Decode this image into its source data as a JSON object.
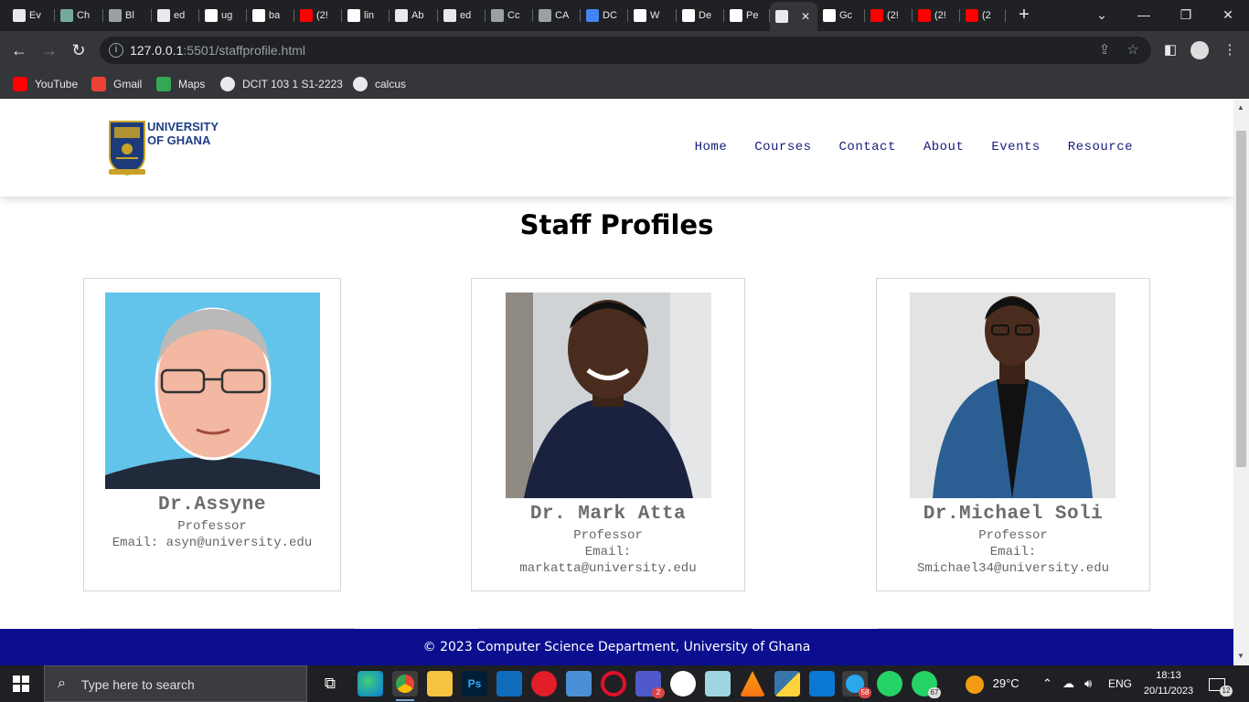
{
  "browser": {
    "tabs": [
      {
        "title": "Ev",
        "icon": "page-icon",
        "color": "#e8eaed"
      },
      {
        "title": "Ch",
        "icon": "chatgpt-icon",
        "color": "#74aa9c"
      },
      {
        "title": "Bl",
        "icon": "globe-icon",
        "color": "#9aa0a6"
      },
      {
        "title": "ed",
        "icon": "page-icon",
        "color": "#e8eaed"
      },
      {
        "title": "ug",
        "icon": "google-icon",
        "color": "#fff"
      },
      {
        "title": "ba",
        "icon": "google-icon",
        "color": "#fff"
      },
      {
        "title": "(2!",
        "icon": "youtube-icon",
        "color": "#ff0000"
      },
      {
        "title": "lin",
        "icon": "google-icon",
        "color": "#fff"
      },
      {
        "title": "Ab",
        "icon": "page-icon",
        "color": "#e8eaed"
      },
      {
        "title": "ed",
        "icon": "page-icon",
        "color": "#e8eaed"
      },
      {
        "title": "Cc",
        "icon": "globe-icon",
        "color": "#9aa0a6"
      },
      {
        "title": "CA",
        "icon": "globe-icon",
        "color": "#9aa0a6"
      },
      {
        "title": "DC",
        "icon": "docs-icon",
        "color": "#4285f4"
      },
      {
        "title": "W",
        "icon": "github-icon",
        "color": "#fff"
      },
      {
        "title": "De",
        "icon": "github-icon",
        "color": "#fff"
      },
      {
        "title": "Pe",
        "icon": "github-icon",
        "color": "#fff"
      },
      {
        "title": "",
        "icon": "page-icon",
        "color": "#e8eaed",
        "active": true
      },
      {
        "title": "Gc",
        "icon": "google-icon",
        "color": "#fff"
      },
      {
        "title": "(2!",
        "icon": "youtube-icon",
        "color": "#ff0000"
      },
      {
        "title": "(2!",
        "icon": "youtube-icon",
        "color": "#ff0000"
      },
      {
        "title": "(2",
        "icon": "youtube-icon",
        "color": "#ff0000"
      }
    ],
    "url_host": "127.0.0.1",
    "url_rest": ":5501/staffprofile.html",
    "bookmarks": [
      {
        "label": "YouTube",
        "icon": "youtube-icon",
        "color": "#ff0000"
      },
      {
        "label": "Gmail",
        "icon": "gmail-icon",
        "color": "#ea4335"
      },
      {
        "label": "Maps",
        "icon": "maps-icon",
        "color": "#34a853"
      },
      {
        "label": "DCIT 103 1 S1-2223",
        "icon": "globe-icon",
        "color": "#e8eaed"
      },
      {
        "label": "calcus",
        "icon": "globe-icon",
        "color": "#e8eaed"
      }
    ]
  },
  "site": {
    "logo_line1": "UNIVERSITY",
    "logo_line2": "OF GHANA",
    "nav": [
      "Home",
      "Courses",
      "Contact",
      "About",
      "Events",
      "Resource"
    ],
    "title": "Staff Profiles",
    "staff": [
      {
        "name": "Dr.Assyne",
        "role": "Professor",
        "email": "Email: asyn@university.edu"
      },
      {
        "name": "Dr. Mark Atta",
        "role": "Professor",
        "email_label": "Email:",
        "email": "markatta@university.edu"
      },
      {
        "name": "Dr.Michael Soli",
        "role": "Professor",
        "email_label": "Email:",
        "email": "Smichael34@university.edu"
      }
    ],
    "footer": "© 2023 Computer Science Department, University of Ghana"
  },
  "taskbar": {
    "search_placeholder": "Type here to search",
    "weather": "29°C",
    "language": "ENG",
    "time": "18:13",
    "date": "20/11/2023",
    "notification_count": "12",
    "teams_badge": "2",
    "telegram_badge": "58",
    "whatsapp_badge": "67"
  }
}
